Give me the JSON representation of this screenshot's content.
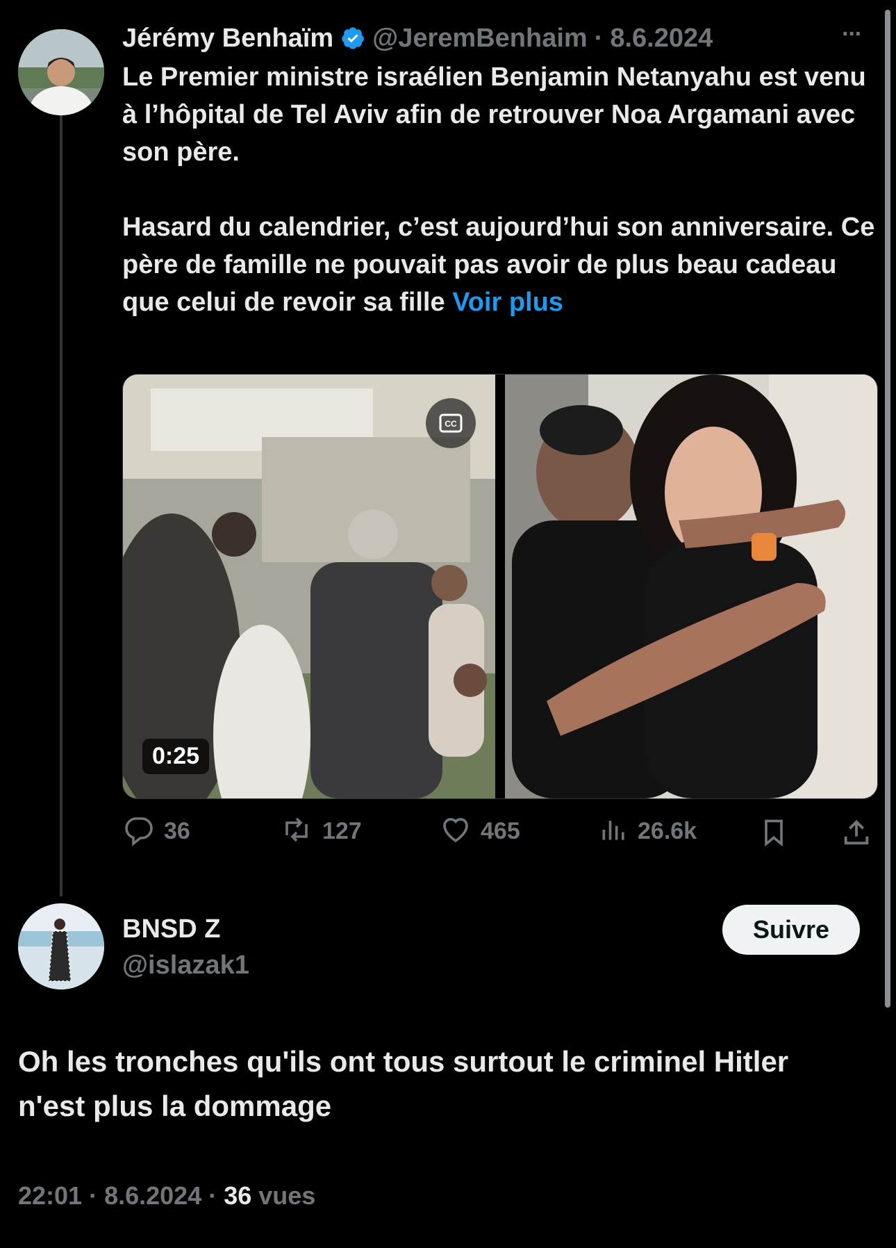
{
  "tweet": {
    "author_name": "Jérémy Benhaïm",
    "handle": "@JeremBenhaim",
    "separator": "·",
    "date": "8.6.2024",
    "more": "···",
    "text_main": "Le Premier ministre israélien Benjamin Netanyahu est venu à l’hôpital de Tel Aviv afin de retrouver Noa Argamani avec son père.\n\nHasard du calendrier, c’est aujourd’hui son anniversaire. Ce père de famille ne pouvait pas avoir de plus beau cadeau que celui de revoir sa fille ",
    "show_more": "Voir plus",
    "video_duration": "0:25",
    "stats": {
      "replies": "36",
      "retweets": "127",
      "likes": "465",
      "views": "26.6k"
    }
  },
  "reply": {
    "author_name": "BNSD Z",
    "handle": "@islazak1",
    "follow_label": "Suivre",
    "text": "Oh les tronches qu'ils ont tous surtout le criminel Hitler n'est plus la dommage",
    "time": "22:01",
    "separator": "·",
    "date": "8.6.2024",
    "views_count": "36",
    "views_label": "vues"
  },
  "colors": {
    "accent": "#1d9bf0",
    "muted": "#71767b",
    "text": "#e7e9ea",
    "background": "#000000"
  }
}
